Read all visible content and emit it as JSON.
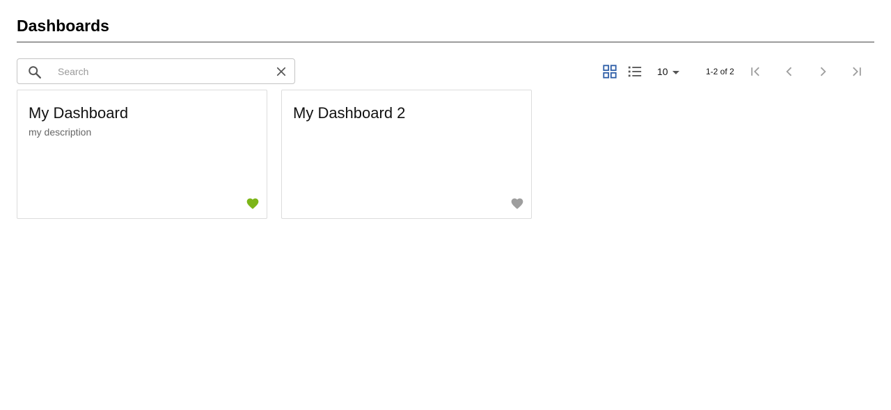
{
  "page": {
    "title": "Dashboards"
  },
  "toolbar": {
    "search": {
      "placeholder": "Search",
      "value": "",
      "icon": "search-icon",
      "clear_icon": "close-icon"
    },
    "view_toggle": {
      "grid_icon": "grid-view-icon",
      "list_icon": "list-view-icon",
      "active": "grid"
    },
    "page_size": "10",
    "range_label": "1-2 of 2",
    "pagination_icons": [
      "first-page-icon",
      "chevron-left-icon",
      "chevron-right-icon",
      "last-page-icon"
    ]
  },
  "dashboards": [
    {
      "title": "My Dashboard",
      "description": "my description",
      "favorite": true
    },
    {
      "title": "My Dashboard 2",
      "description": "",
      "favorite": false
    }
  ],
  "colors": {
    "accent": "#2f5fa8",
    "favorite_on": "#7cb518",
    "favorite_off": "#9e9e9e",
    "icon_gray": "#555555",
    "pager_disabled": "#9e9e9e"
  }
}
